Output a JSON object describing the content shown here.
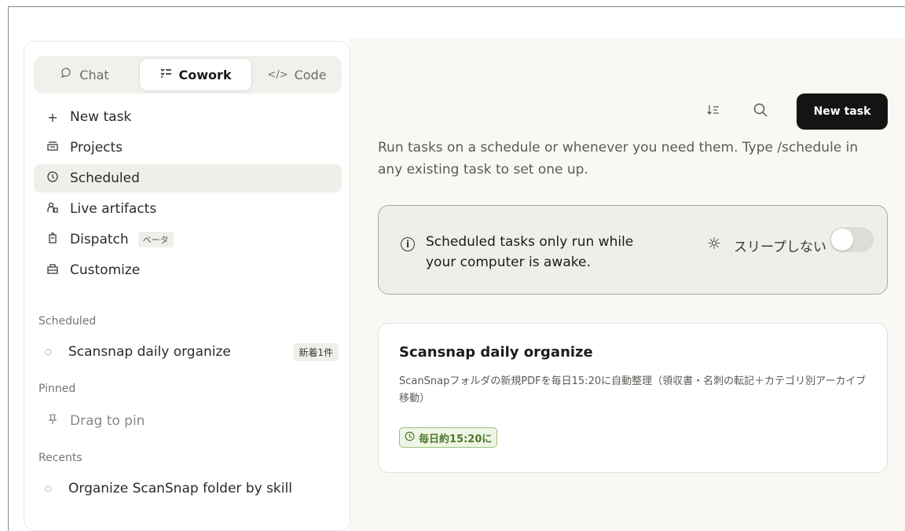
{
  "modes": {
    "chat": {
      "label": "Chat",
      "icon": "chat-bubble-icon"
    },
    "cowork": {
      "label": "Cowork",
      "icon": "cowork-icon"
    },
    "code": {
      "label": "Code",
      "icon": "code-icon"
    },
    "active": "cowork"
  },
  "nav": {
    "new_task": "New task",
    "projects": "Projects",
    "scheduled": "Scheduled",
    "live_artifacts": "Live artifacts",
    "dispatch": "Dispatch",
    "dispatch_badge": "ベータ",
    "customize": "Customize"
  },
  "sections": {
    "scheduled_title": "Scheduled",
    "scheduled_items": [
      {
        "label": "Scansnap daily organize",
        "badge": "新着1件"
      }
    ],
    "pinned_title": "Pinned",
    "pinned_placeholder": "Drag to pin",
    "recents_title": "Recents",
    "recents_items": [
      {
        "label": "Organize ScanSnap folder by skill"
      }
    ]
  },
  "toolbar": {
    "sort_icon": "sort-icon",
    "search_icon": "search-icon",
    "new_task_label": "New task"
  },
  "main": {
    "description": "Run tasks on a schedule or whenever you need them. Type /schedule in any existing task to set one up.",
    "notice": {
      "message": "Scheduled tasks only run while your computer is awake.",
      "sleep_label": "スリープしない",
      "toggle_on": false
    },
    "task": {
      "title": "Scansnap daily organize",
      "description": "ScanSnapフォルダの新規PDFを毎日15:20に自動整理（領収書・名刺の転記＋カテゴリ別アーカイブ移動）",
      "schedule": "毎日約15:20に"
    }
  },
  "colors": {
    "accent_dark": "#141413",
    "schedule_green": "#4e7a2b",
    "background_main": "#f9f8f5"
  }
}
